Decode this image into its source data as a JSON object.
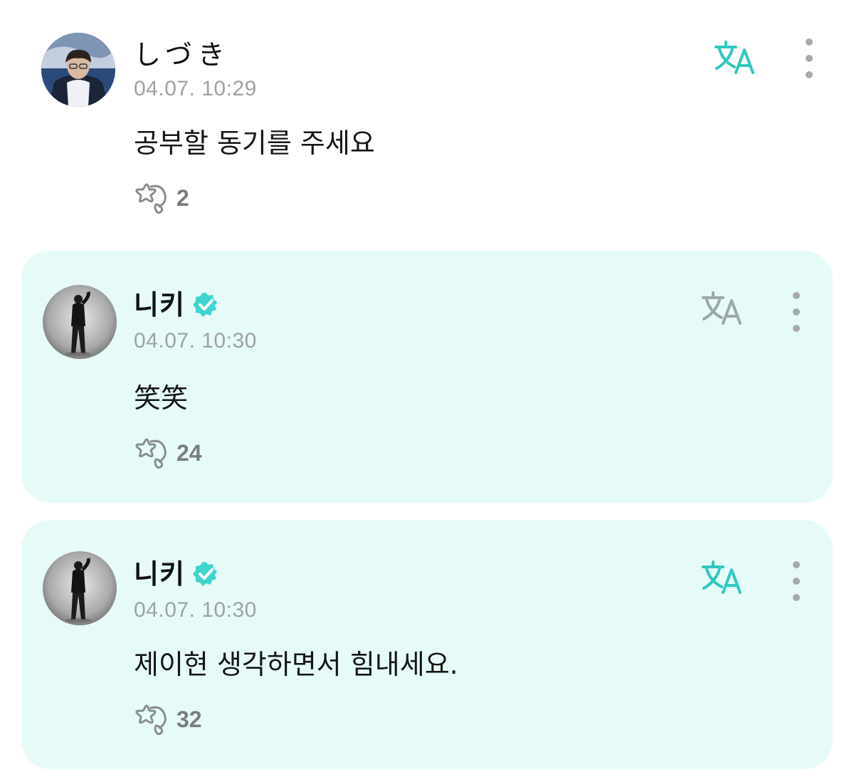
{
  "colors": {
    "accent": "#30c8c0",
    "muted_translate": "#9ca8aa",
    "highlight_background": "#e6fbf8",
    "timestamp": "#9ea1a5",
    "count": "#7a7d80",
    "verified_badge": "#3fd4cf"
  },
  "comments": [
    {
      "author": "しづき",
      "verified": false,
      "timestamp": "04.07. 10:29",
      "text": "공부할 동기를 주세요",
      "reaction_count": "2",
      "highlighted": false,
      "translate_icon": "translate-icon",
      "more_icon": "more-vertical-icon"
    },
    {
      "author": "니키",
      "verified": true,
      "timestamp": "04.07. 10:30",
      "text": "笑笑",
      "reaction_count": "24",
      "highlighted": true,
      "translate_icon": "translate-icon",
      "more_icon": "more-vertical-icon"
    },
    {
      "author": "니키",
      "verified": true,
      "timestamp": "04.07. 10:30",
      "text": "제이현 생각하면서 힘내세요.",
      "reaction_count": "32",
      "highlighted": true,
      "translate_icon": "translate-icon",
      "more_icon": "more-vertical-icon"
    }
  ]
}
